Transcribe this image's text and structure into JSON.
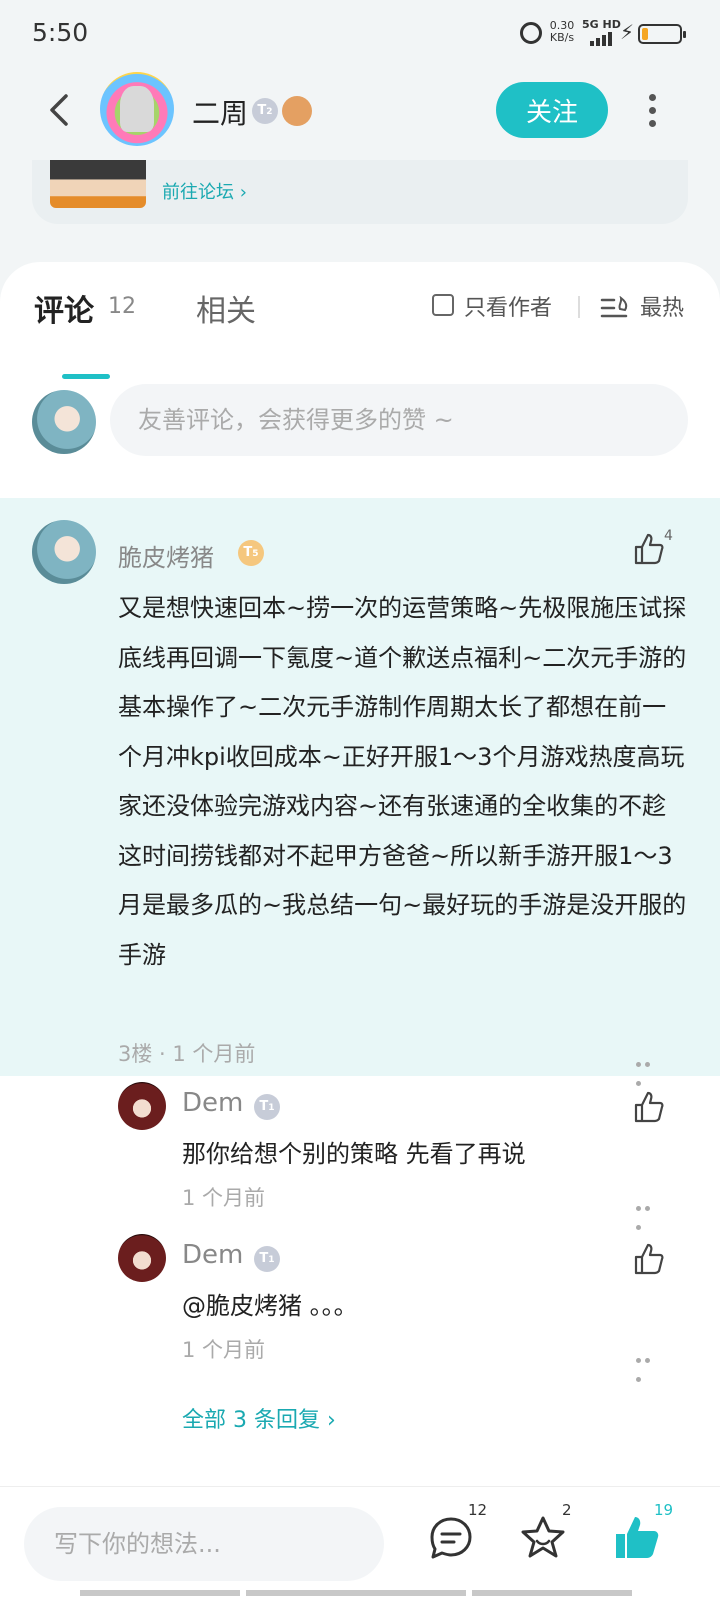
{
  "status_bar": {
    "time": "5:50",
    "speed_value": "0.30",
    "speed_unit": "KB/s",
    "network": "5G HD",
    "battery_level": 0.18,
    "icons": [
      "alarm-icon",
      "signal-icon",
      "charging-icon",
      "battery-icon"
    ]
  },
  "header": {
    "author_name": "二周",
    "author_level": "2",
    "follow_label": "关注",
    "icons": [
      "back-icon",
      "more-vertical-icon"
    ]
  },
  "game_card": {
    "forum_link": "前往论坛 ›"
  },
  "tabs": {
    "comments_label": "评论",
    "comments_count": "12",
    "related_label": "相关",
    "only_author_label": "只看作者",
    "sort_label": "最热"
  },
  "comment_input": {
    "placeholder": "友善评论，会获得更多的赞 ~"
  },
  "main_comment": {
    "author": "脆皮烤猪",
    "level": "5",
    "likes": "4",
    "body": "又是想快速回本~捞一次的运营策略~先极限施压试探底线再回调一下氪度~道个歉送点福利~二次元手游的基本操作了~二次元手游制作周期太长了都想在前一个月冲kpi收回成本~正好开服1～3个月游戏热度高玩家还没体验完游戏内容~还有张速通的全收集的不趁这时间捞钱都对不起甲方爸爸~所以新手游开服1～3月是最多瓜的~我总结一句~最好玩的手游是没开服的手游",
    "meta": "3楼 · 1 个月前"
  },
  "replies": [
    {
      "author": "Dem",
      "level": "1",
      "body": "那你给想个别的策略 先看了再说",
      "time": "1 个月前"
    },
    {
      "author": "Dem",
      "level": "1",
      "body": "@脆皮烤猪 。。。",
      "time": "1 个月前"
    }
  ],
  "all_replies_label": "全部 3 条回复 ›",
  "bottom_bar": {
    "placeholder": "写下你的想法...",
    "comment_count": "12",
    "favorite_count": "2",
    "like_count": "19"
  },
  "colors": {
    "accent": "#1fc0c6",
    "highlight_bg": "#e8f7f7"
  }
}
